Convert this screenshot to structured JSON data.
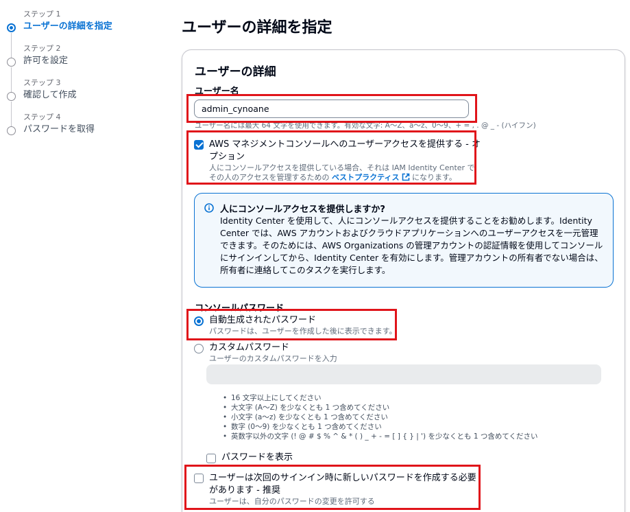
{
  "stepper": {
    "steps": [
      {
        "small": "ステップ 1",
        "title": "ユーザーの詳細を指定",
        "active": true
      },
      {
        "small": "ステップ 2",
        "title": "許可を設定",
        "active": false
      },
      {
        "small": "ステップ 3",
        "title": "確認して作成",
        "active": false
      },
      {
        "small": "ステップ 4",
        "title": "パスワードを取得",
        "active": false
      }
    ]
  },
  "page": {
    "title": "ユーザーの詳細を指定"
  },
  "card": {
    "title": "ユーザーの詳細",
    "username_label": "ユーザー名",
    "username_value": "admin_cynoane",
    "username_constraint": "ユーザー名には最大 64 文字を使用できます。有効な文字: A〜Z、a〜z、0〜9、+ = , . @ _ - (ハイフン)",
    "console_access": {
      "checked": true,
      "label_line1": "AWS マネジメントコンソールへのユーザーアクセスを提供する - オ",
      "label_line2": "プション",
      "desc_line1": "人にコンソールアクセスを提供している場合、それは IAM Identity Center で",
      "desc_line2_prefix": "その人のアクセスを管理するための ",
      "desc_link": "ベストプラクティス",
      "desc_line2_suffix": " になります。"
    },
    "info": {
      "title": "人にコンソールアクセスを提供しますか?",
      "lines": [
        "Identity Center を使用して、人にコンソールアクセスを提供することをお勧めします。Identity",
        "Center では、AWS アカウントおよびクラウドアプリケーションへのユーザーアクセスを一元管理",
        "できます。そのためには、AWS Organizations の管理アカウントの認証情報を使用してコンソール",
        "にサインインしてから、Identity Center を有効にします。管理アカウントの所有者でない場合は、",
        "所有者に連絡してこのタスクを実行します。"
      ]
    },
    "password_section_label": "コンソールパスワード",
    "auto_password": {
      "label": "自動生成されたパスワード",
      "desc": "パスワードは、ユーザーを作成した後に表示できます。",
      "selected": true
    },
    "custom_password": {
      "label": "カスタムパスワード",
      "desc": "ユーザーのカスタムパスワードを入力",
      "selected": false
    },
    "password_rules": [
      "16 文字以上にしてください",
      "大文字 (A〜Z) を少なくとも 1 つ含めてください",
      "小文字 (a〜z) を少なくとも 1 つ含めてください",
      "数字 (0〜9) を少なくとも 1 つ含めてください",
      "英数字以外の文字 (! @ # $ % ^ & * ( ) _ + - = [ ] { } | ') を少なくとも 1 つ含めてください"
    ],
    "show_password": {
      "label": "パスワードを表示",
      "checked": false
    },
    "require_reset": {
      "checked": false,
      "label_line1": "ユーザーは次回のサインイン時に新しいパスワードを作成する必要",
      "label_line2": "があります - 推奨",
      "desc": "ユーザーは、自分のパスワードの変更を許可する"
    }
  },
  "colors": {
    "accent": "#0972d3",
    "highlight": "#e0141a",
    "info_bg": "#f2f8fd"
  }
}
